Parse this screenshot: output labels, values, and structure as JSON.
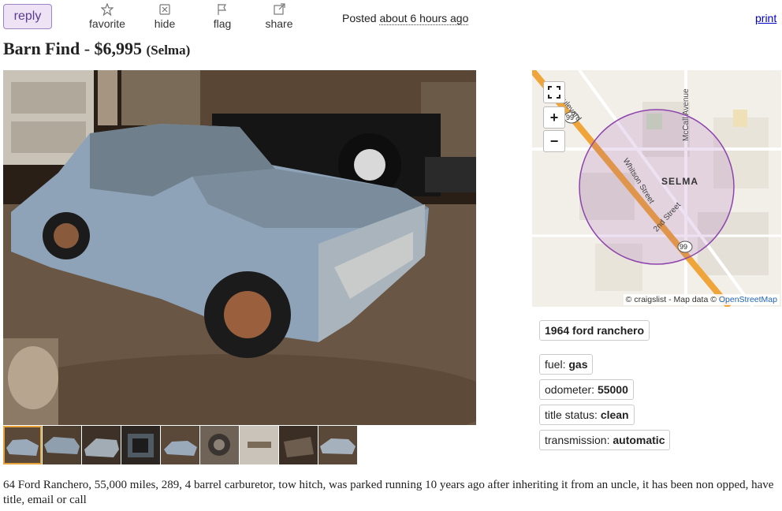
{
  "toolbar": {
    "reply_label": "reply",
    "favorite_label": "favorite",
    "hide_label": "hide",
    "flag_label": "flag",
    "share_label": "share",
    "posted_prefix": "Posted",
    "posted_ago": "about 6 hours ago",
    "print_label": "print"
  },
  "title": {
    "name": "Barn Find",
    "dash": " - ",
    "price": "$6,995",
    "location": "(Selma)"
  },
  "gallery": {
    "thumbnail_count": 9,
    "active_index": 0
  },
  "map": {
    "town_label": "SELMA",
    "streets": [
      "Whitson Street",
      "2nd Street",
      "McCall Avenue",
      "ire Boulevard"
    ],
    "highway_shield": "99",
    "expand_icon": "fullscreen-icon",
    "zoom_in_label": "+",
    "zoom_out_label": "−",
    "attribution_prefix": "© craigslist - Map data ©",
    "attribution_link": "OpenStreetMap"
  },
  "attributes": {
    "heading": "1964 ford ranchero",
    "fuel_label": "fuel:",
    "fuel_value": "gas",
    "odometer_label": "odometer:",
    "odometer_value": "55000",
    "title_status_label": "title status:",
    "title_status_value": "clean",
    "transmission_label": "transmission:",
    "transmission_value": "automatic"
  },
  "description": "64 Ford Ranchero, 55,000 miles, 289, 4 barrel carburetor, tow hitch, was parked running 10 years ago after inheriting it from an uncle, it has been non opped, have title, email or call",
  "colors": {
    "reply_bg": "#eee3f5",
    "reply_text": "#5c3c92",
    "link": "#0000cc",
    "map_radius": "#8e44ad",
    "highway": "#f0a53a",
    "thumb_active": "#e8a33a"
  }
}
